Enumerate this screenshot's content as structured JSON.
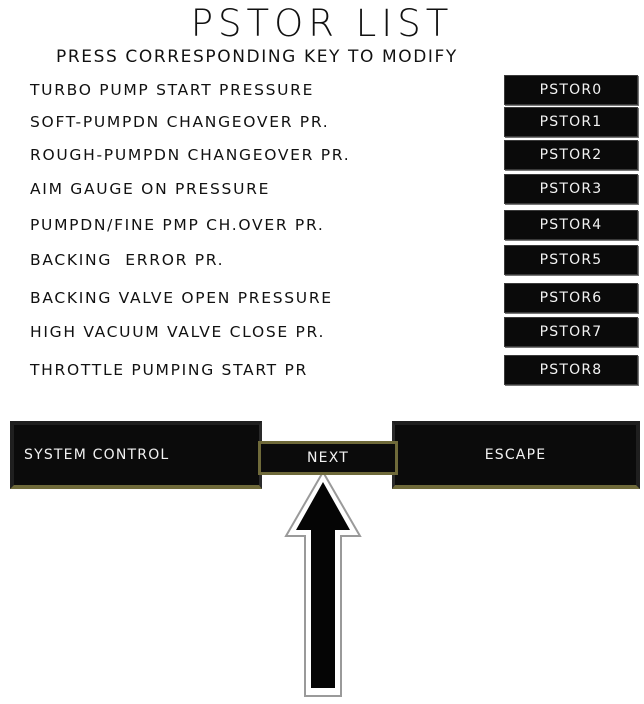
{
  "header": {
    "title": "PSTOR LIST",
    "subtitle": "PRESS CORRESPONDING KEY TO MODIFY"
  },
  "rows": [
    {
      "label": "TURBO PUMP START PRESSURE",
      "key": "PSTOR0"
    },
    {
      "label": "SOFT-PUMPDN CHANGEOVER PR.",
      "key": "PSTOR1"
    },
    {
      "label": "ROUGH-PUMPDN CHANGEOVER PR.",
      "key": "PSTOR2"
    },
    {
      "label": "AIM GAUGE ON PRESSURE",
      "key": "PSTOR3"
    },
    {
      "label": "PUMPDN/FINE PMP CH.OVER PR.",
      "key": "PSTOR4"
    },
    {
      "label": "BACKING  ERROR PR.",
      "key": "PSTOR5"
    },
    {
      "label": "BACKING VALVE OPEN PRESSURE",
      "key": "PSTOR6"
    },
    {
      "label": "HIGH VACUUM VALVE CLOSE PR.",
      "key": "PSTOR7"
    },
    {
      "label": "THROTTLE PUMPING START PR",
      "key": "PSTOR8"
    }
  ],
  "footer": {
    "system_control": "SYSTEM CONTROL",
    "next": "NEXT",
    "escape": "ESCAPE"
  },
  "annotation": {
    "icon": "arrow-up-icon",
    "points_to": "NEXT"
  },
  "colors": {
    "background": "#ffffff",
    "button_fill": "#0b0b0b",
    "button_text": "#f2f2f2",
    "button_edge": "#6f6a3a"
  }
}
